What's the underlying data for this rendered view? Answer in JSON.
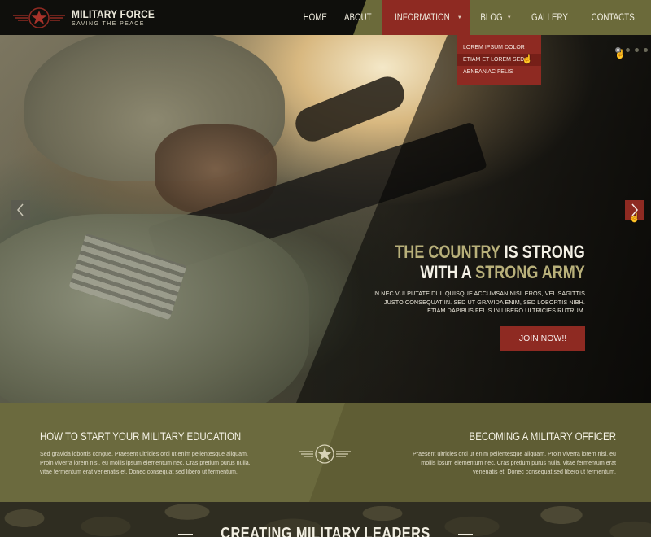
{
  "brand": {
    "title": "MILITARY FORCE",
    "subtitle": "SAVING THE PEACE",
    "logo_icon": "star-emblem-icon"
  },
  "nav": {
    "items": [
      {
        "label": "HOME"
      },
      {
        "label": "ABOUT"
      },
      {
        "label": "INFORMATION",
        "active": true,
        "has_dropdown": true
      },
      {
        "label": "BLOG",
        "has_dropdown": true
      },
      {
        "label": "GALLERY"
      },
      {
        "label": "CONTACTS"
      }
    ],
    "dropdown": [
      "LOREM IPSUM DOLOR",
      "ETIAM ET LOREM SED",
      "AENEAN AC FELIS"
    ]
  },
  "hero": {
    "heading_line1_highlight": "THE COUNTRY",
    "heading_line1_rest": " IS STRONG",
    "heading_line2_start": "WITH A ",
    "heading_line2_highlight": "STRONG ARMY",
    "text_line1": "IN NEC VULPUTATE DUI. QUISQUE ACCUMSAN NISL EROS, VEL SAGITTIS",
    "text_line2": "JUSTO CONSEQUAT IN. SED UT GRAVIDA ENIM, SED LOBORTIS NIBH.",
    "text_line3": "ETIAM DAPIBUS FELIS IN LIBERO ULTRICIES RUTRUM.",
    "cta": "JOIN NOW!!",
    "prev_icon": "chevron-left-icon",
    "next_icon": "chevron-right-icon",
    "slides_count": 4,
    "active_slide": 1
  },
  "features": {
    "left": {
      "title": "HOW TO START YOUR MILITARY EDUCATION",
      "text": "Sed gravida lobortis congue. Praesent ultricies orci ut enim pellentesque aliquam. Proin viverra lorem nisi, eu mollis ipsum elementum nec. Cras pretium purus nulla, vitae fermentum erat venenatis et. Donec consequat sed libero ut fermentum."
    },
    "right": {
      "title": "BECOMING A MILITARY OFFICER",
      "text": "Praesent ultricies orci ut enim pellentesque aliquam. Proin viverra lorem nisi, eu mollis ipsum elementum nec. Cras pretium purus nulla, vitae fermentum erat venenatis et. Donec consequat sed libero ut fermentum."
    },
    "emblem_icon": "star-emblem-icon"
  },
  "band": {
    "title": "CREATING MILITARY LEADERS"
  },
  "colors": {
    "accent_red": "#8e2a22",
    "olive": "#6b6a3e",
    "highlight": "#b8b07a"
  }
}
